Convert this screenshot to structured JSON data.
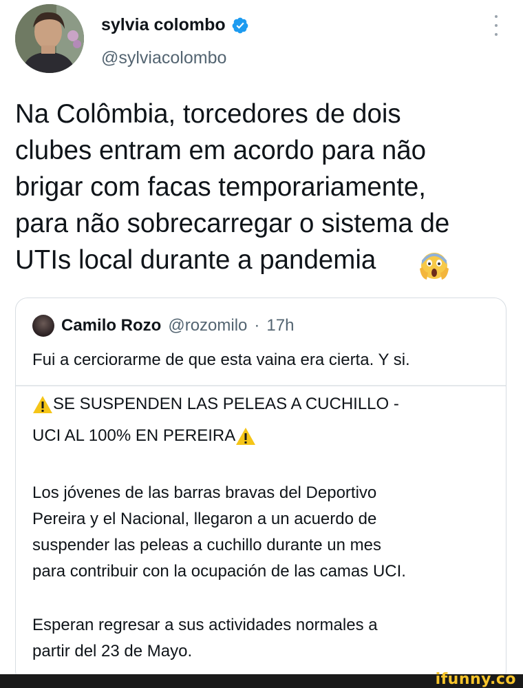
{
  "tweet": {
    "display_name": "sylvia colombo",
    "handle": "@sylviacolombo",
    "text": "Na Colômbia, torcedores de dois\nclubes entram em acordo para não\nbrigar com facas temporariamente,\npara não sobrecarregar o sistema de\nUTIs local durante a pandemia",
    "emoji_icon": "screaming-face-emoji",
    "verified_color": "#1d9bf0"
  },
  "quote": {
    "display_name": "Camilo Rozo",
    "handle": "@rozomilo",
    "dot": "·",
    "time": "17h",
    "text": "Fui a cerciorarme de que esta vaina era cierta. Y si.",
    "card": {
      "headline_1": "SE SUSPENDEN LAS PELEAS A CUCHILLO -",
      "headline_2": "UCI AL 100% EN PEREIRA",
      "paragraph_1": "Los jóvenes de las barras bravas del Deportivo\nPereira y el Nacional, llegaron a un acuerdo de\nsuspender las peleas a cuchillo durante un mes\npara contribuir con la ocupación de las camas UCI.",
      "paragraph_2": "Esperan regresar a sus actividades normales a\npartir del 23 de Mayo.",
      "warning_icon": "warning-icon",
      "warning_color": "#f5c518"
    }
  },
  "footer": {
    "watermark": "ifunny.co",
    "watermark_color": "#f7c42a"
  }
}
